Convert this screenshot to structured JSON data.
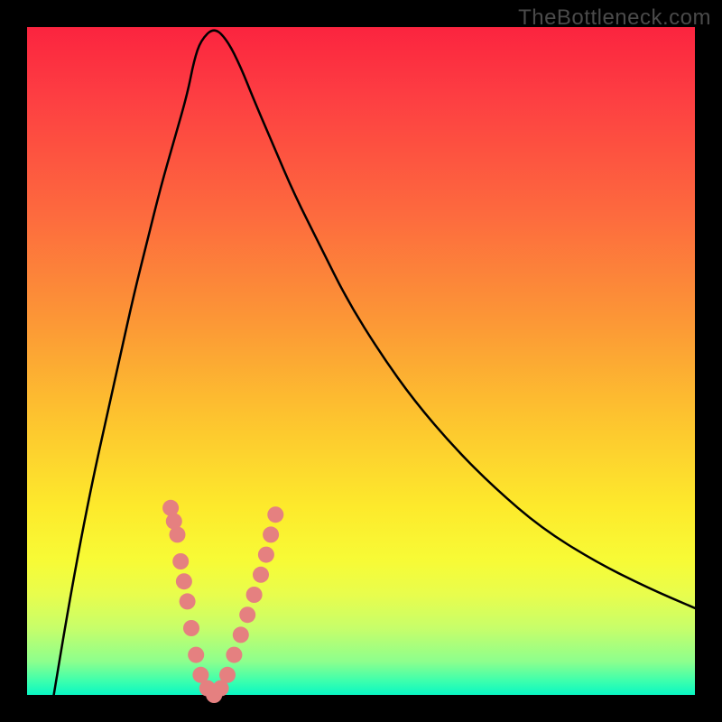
{
  "watermark": "TheBottleneck.com",
  "colors": {
    "frame": "#000000",
    "curve": "#000000",
    "dot": "#e58080",
    "gradient_top": "#fb243f",
    "gradient_bottom": "#09f7c4"
  },
  "chart_data": {
    "type": "line",
    "title": "",
    "xlabel": "",
    "ylabel": "",
    "xlim": [
      0,
      100
    ],
    "ylim": [
      0,
      100
    ],
    "grid": false,
    "legend": false,
    "series": [
      {
        "name": "bottleneck-curve",
        "x": [
          4,
          6,
          8,
          10,
          12,
          14,
          16,
          18,
          20,
          22,
          24,
          25,
          26,
          28,
          30,
          32,
          34,
          37,
          40,
          44,
          48,
          53,
          58,
          64,
          70,
          77,
          85,
          93,
          100
        ],
        "y": [
          100,
          88,
          77,
          67,
          58,
          49,
          40,
          32,
          24,
          17,
          10,
          5,
          2,
          0,
          2,
          6,
          11,
          18,
          25,
          33,
          41,
          49,
          56,
          63,
          69,
          75,
          80,
          84,
          87
        ]
      }
    ],
    "points": [
      {
        "name": "marker",
        "x": 21.5,
        "y": 72
      },
      {
        "name": "marker",
        "x": 22,
        "y": 74
      },
      {
        "name": "marker",
        "x": 22.5,
        "y": 76
      },
      {
        "name": "marker",
        "x": 23,
        "y": 80
      },
      {
        "name": "marker",
        "x": 23.5,
        "y": 83
      },
      {
        "name": "marker",
        "x": 24,
        "y": 86
      },
      {
        "name": "marker",
        "x": 24.6,
        "y": 90
      },
      {
        "name": "marker",
        "x": 25.3,
        "y": 94
      },
      {
        "name": "marker",
        "x": 26,
        "y": 97
      },
      {
        "name": "marker",
        "x": 27,
        "y": 99
      },
      {
        "name": "marker",
        "x": 28,
        "y": 100
      },
      {
        "name": "marker",
        "x": 29,
        "y": 99
      },
      {
        "name": "marker",
        "x": 30,
        "y": 97
      },
      {
        "name": "marker",
        "x": 31,
        "y": 94
      },
      {
        "name": "marker",
        "x": 32,
        "y": 91
      },
      {
        "name": "marker",
        "x": 33,
        "y": 88
      },
      {
        "name": "marker",
        "x": 34,
        "y": 85
      },
      {
        "name": "marker",
        "x": 35,
        "y": 82
      },
      {
        "name": "marker",
        "x": 35.8,
        "y": 79
      },
      {
        "name": "marker",
        "x": 36.5,
        "y": 76
      },
      {
        "name": "marker",
        "x": 37.2,
        "y": 73
      }
    ],
    "annotations": [
      {
        "text": "TheBottleneck.com",
        "note": "watermark top-right, outside plot area"
      }
    ]
  }
}
